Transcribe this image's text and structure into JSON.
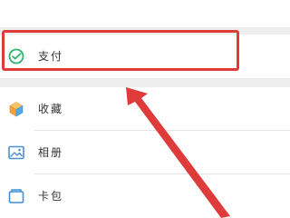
{
  "menu": {
    "items": [
      {
        "label": "支付",
        "icon": "wechat-pay-icon"
      },
      {
        "label": "收藏",
        "icon": "favorites-cube-icon"
      },
      {
        "label": "相册",
        "icon": "album-picture-icon"
      },
      {
        "label": "卡包",
        "icon": "card-wallet-icon"
      }
    ]
  },
  "annotation": {
    "highlight_color": "#e03b3b",
    "arrow_color": "#e03b3b"
  }
}
